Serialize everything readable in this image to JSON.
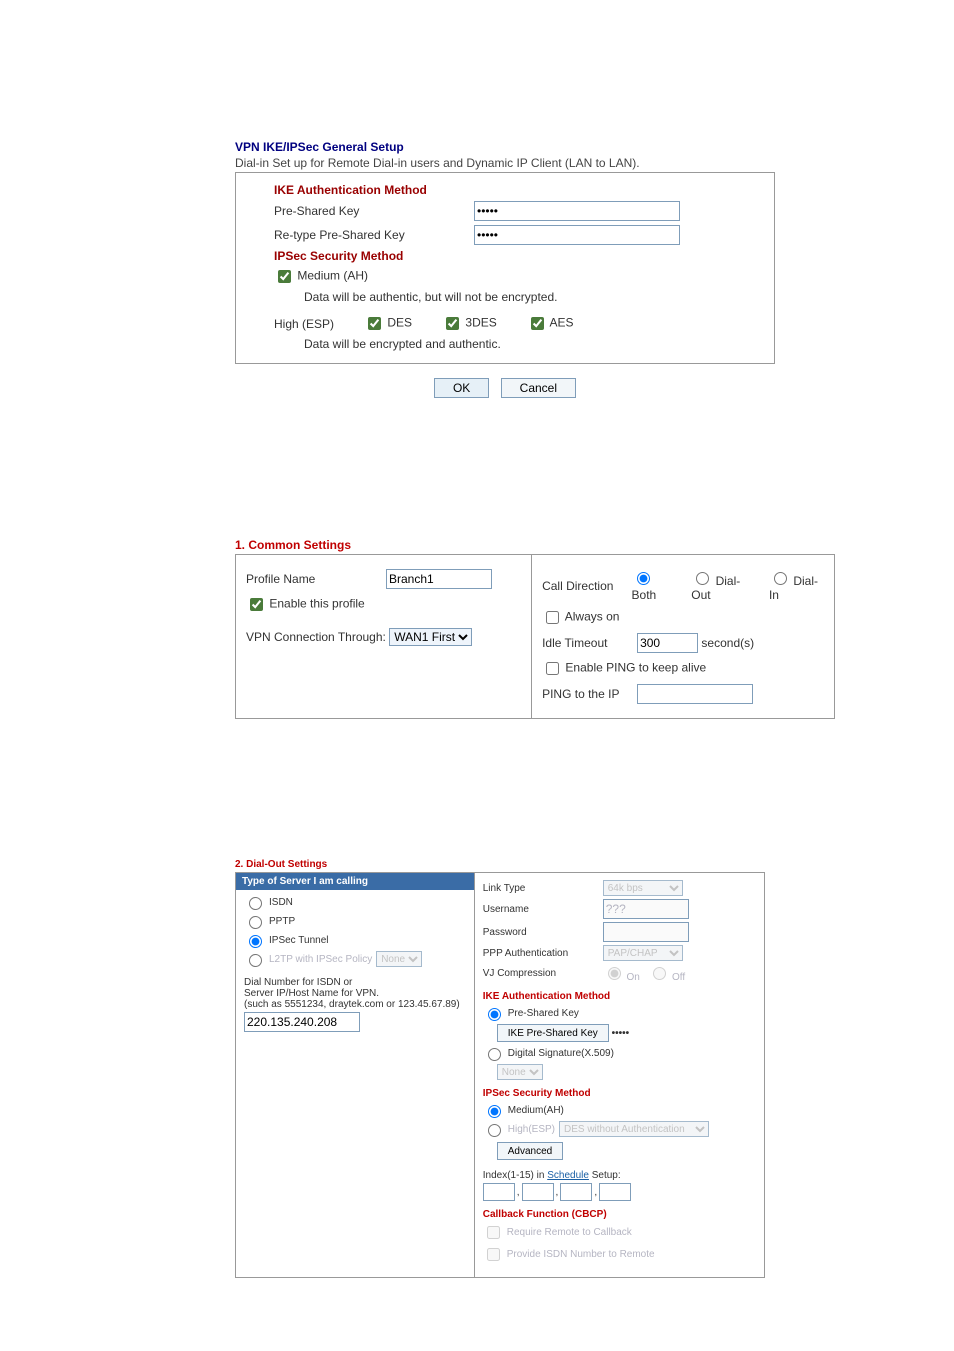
{
  "vpn_general": {
    "title": "VPN IKE/IPSec General Setup",
    "subtitle": "Dial-in Set up for Remote Dial-in users and Dynamic IP Client (LAN to LAN).",
    "ike_auth_heading": "IKE Authentication Method",
    "psk_label": "Pre-Shared Key",
    "psk_value": "•••••",
    "repsk_label": "Re-type Pre-Shared Key",
    "repsk_value": "•••••",
    "ipsec_sec_heading": "IPSec Security Method",
    "medium_checked": true,
    "medium_label": "Medium (AH)",
    "medium_desc": "Data will be authentic, but will not be encrypted.",
    "high_label": "High (ESP)",
    "des_checked": true,
    "des_label": "DES",
    "tdes_checked": true,
    "tdes_label": "3DES",
    "aes_checked": true,
    "aes_label": "AES",
    "high_desc": "Data will be encrypted and authentic.",
    "ok_label": "OK",
    "cancel_label": "Cancel"
  },
  "common": {
    "title": "1. Common Settings",
    "profile_name_label": "Profile Name",
    "profile_name_value": "Branch1",
    "enable_profile_checked": true,
    "enable_profile_label": "Enable this profile",
    "vpn_conn_label": "VPN Connection Through:",
    "vpn_conn_value": "WAN1 First",
    "call_dir_label": "Call Direction",
    "call_dir_options": {
      "both": "Both",
      "dialout": "Dial-Out",
      "dialin": "Dial-In"
    },
    "call_dir_selected": "both",
    "always_on_label": "Always on",
    "always_on_checked": false,
    "idle_label": "Idle Timeout",
    "idle_value": "300",
    "idle_unit": "second(s)",
    "ping_keep_label": "Enable PING to keep alive",
    "ping_keep_checked": false,
    "ping_to_label": "PING to the IP",
    "ping_to_value": ""
  },
  "dialout": {
    "title": "2. Dial-Out Settings",
    "type_header": "Type of Server I am calling",
    "opts": {
      "isdn": "ISDN",
      "pptp": "PPTP",
      "ipsec": "IPSec Tunnel",
      "l2tp": "L2TP with IPSec Policy",
      "l2tp_policy": "None"
    },
    "selected_type": "ipsec",
    "dial_caption1": "Dial Number for ISDN or",
    "dial_caption2": "Server IP/Host Name for VPN.",
    "dial_caption3": "(such as 5551234, draytek.com or 123.45.67.89)",
    "dial_value": "220.135.240.208",
    "link_type_label": "Link Type",
    "link_type_value": "64k bps",
    "username_label": "Username",
    "username_value": "???",
    "password_label": "Password",
    "password_value": "",
    "pppauth_label": "PPP Authentication",
    "pppauth_value": "PAP/CHAP",
    "vj_label": "VJ Compression",
    "vj_on": "On",
    "vj_off": "Off",
    "vj_selected": "on",
    "ike_auth_heading": "IKE Authentication Method",
    "psk_radio_label": "Pre-Shared Key",
    "psk_button_label": "IKE Pre-Shared Key",
    "psk_button_value": "•••••",
    "dsig_label": "Digital Signature(X.509)",
    "dsig_value": "None",
    "ipsec_sec_heading": "IPSec Security Method",
    "medium_label": "Medium(AH)",
    "high_label": "High(ESP)",
    "high_select_value": "DES without Authentication",
    "advanced_label": "Advanced",
    "sched_line": "Index(1-15) in ",
    "sched_link": "Schedule",
    "sched_after": " Setup:",
    "cb_heading": "Callback Function (CBCP)",
    "cb_req_label": "Require Remote to Callback",
    "cb_prov_label": "Provide ISDN Number to Remote"
  }
}
